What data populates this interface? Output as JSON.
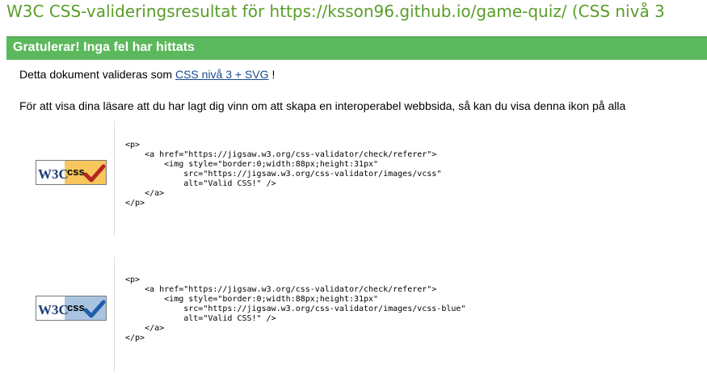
{
  "header": {
    "title": "W3C CSS-valideringsresultat för https://ksson96.github.io/game-quiz/ (CSS nivå 3"
  },
  "banner": {
    "text": "Gratulerar! Inga fel har hittats"
  },
  "info": {
    "validated_prefix": "Detta dokument valideras som",
    "validated_link": "CSS nivå 3 + SVG",
    "validated_suffix": "!",
    "icon_text": "För att visa dina läsare att du har lagt dig vinn om att skapa en interoperabel webbsida, så kan du visa denna ikon på alla"
  },
  "badges": [
    {
      "code": "<p>\n    <a href=\"https://jigsaw.w3.org/css-validator/check/referer\">\n        <img style=\"border:0;width:88px;height:31px\"\n            src=\"https://jigsaw.w3.org/css-validator/images/vcss\"\n            alt=\"Valid CSS!\" />\n    </a>\n</p>",
      "w3c_label": "W3C",
      "css_label": "css",
      "color": "#f7c65c",
      "check_color": "#b3261e"
    },
    {
      "code": "<p>\n    <a href=\"https://jigsaw.w3.org/css-validator/check/referer\">\n        <img style=\"border:0;width:88px;height:31px\"\n            src=\"https://jigsaw.w3.org/css-validator/images/vcss-blue\"\n            alt=\"Valid CSS!\" />\n    </a>\n</p>",
      "w3c_label": "W3C",
      "css_label": "css",
      "color": "#a8c4e0",
      "check_color": "#1f5fa8"
    }
  ]
}
